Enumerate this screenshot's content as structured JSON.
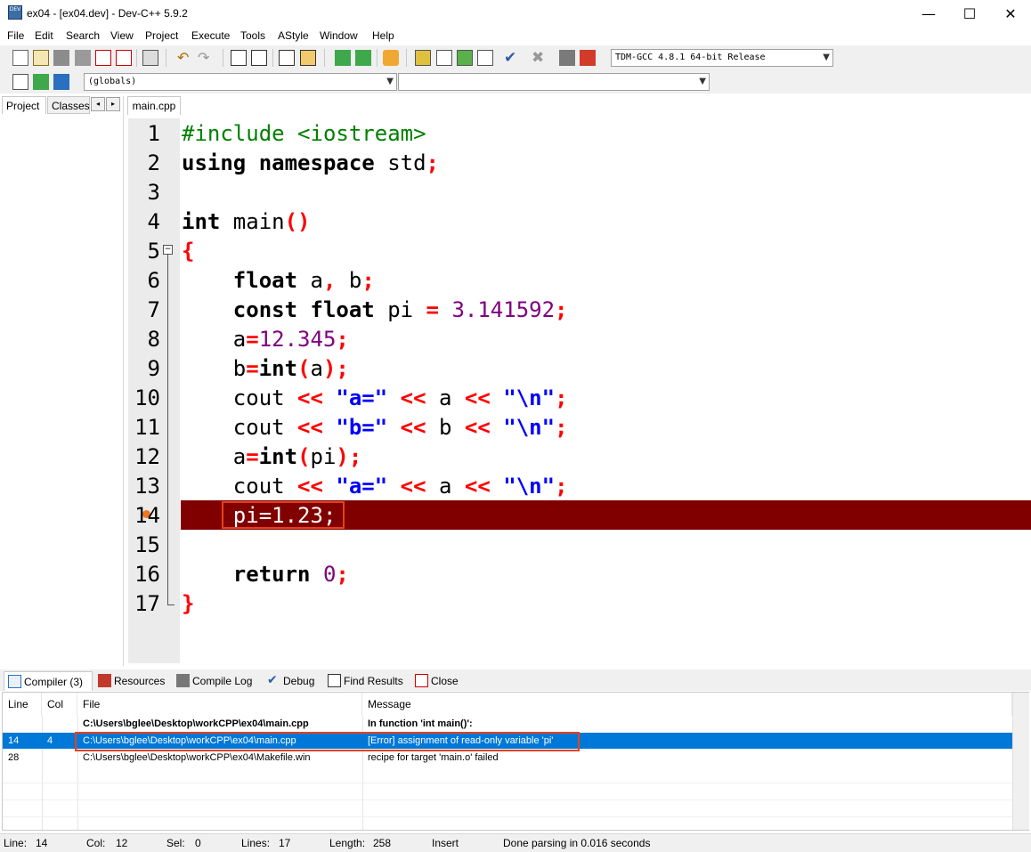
{
  "window": {
    "title": "ex04 - [ex04.dev] - Dev-C++ 5.9.2",
    "app_icon_text": "DEV",
    "minimize": "—",
    "maximize": "☐",
    "close": "✕"
  },
  "menu": [
    "File",
    "Edit",
    "Search",
    "View",
    "Project",
    "Execute",
    "Tools",
    "AStyle",
    "Window",
    "Help"
  ],
  "toolbar": {
    "compiler_select": "TDM-GCC 4.8.1 64-bit Release",
    "scope_select": "(globals)",
    "function_select": ""
  },
  "left_panel": {
    "tabs": [
      "Project",
      "Classes"
    ],
    "nav_prev": "◂",
    "nav_next": "▸"
  },
  "editor": {
    "file_tab": "main.cpp",
    "fold_marker": "⊟",
    "error_line": 14,
    "error_line_color": "#800000",
    "lines": [
      "1",
      "2",
      "3",
      "4",
      "5",
      "6",
      "7",
      "8",
      "9",
      "10",
      "11",
      "12",
      "13",
      "14",
      "15",
      "16",
      "17"
    ]
  },
  "bottom_tabs": [
    "Compiler (3)",
    "Resources",
    "Compile Log",
    "Debug",
    "Find Results",
    "Close"
  ],
  "compiler": {
    "headers": {
      "line": "Line",
      "col": "Col",
      "file": "File",
      "message": "Message"
    },
    "rows": [
      {
        "line": "",
        "col": "",
        "file": "C:\\Users\\bglee\\Desktop\\workCPP\\ex04\\main.cpp",
        "message": "In function 'int main()':"
      },
      {
        "line": "14",
        "col": "4",
        "file": "C:\\Users\\bglee\\Desktop\\workCPP\\ex04\\main.cpp",
        "message": "[Error] assignment of read-only variable 'pi'"
      },
      {
        "line": "28",
        "col": "",
        "file": "C:\\Users\\bglee\\Desktop\\workCPP\\ex04\\Makefile.win",
        "message": "recipe for target 'main.o' failed"
      }
    ],
    "selected_color": "#0078d7",
    "highlight_color": "#e8401c"
  },
  "status": {
    "line_label": "Line:",
    "line_value": "14",
    "col_label": "Col:",
    "col_value": "12",
    "sel_label": "Sel:",
    "sel_value": "0",
    "lines_label": "Lines:",
    "lines_value": "17",
    "length_label": "Length:",
    "length_value": "258",
    "mode": "Insert",
    "message": "Done parsing in 0.016 seconds"
  }
}
